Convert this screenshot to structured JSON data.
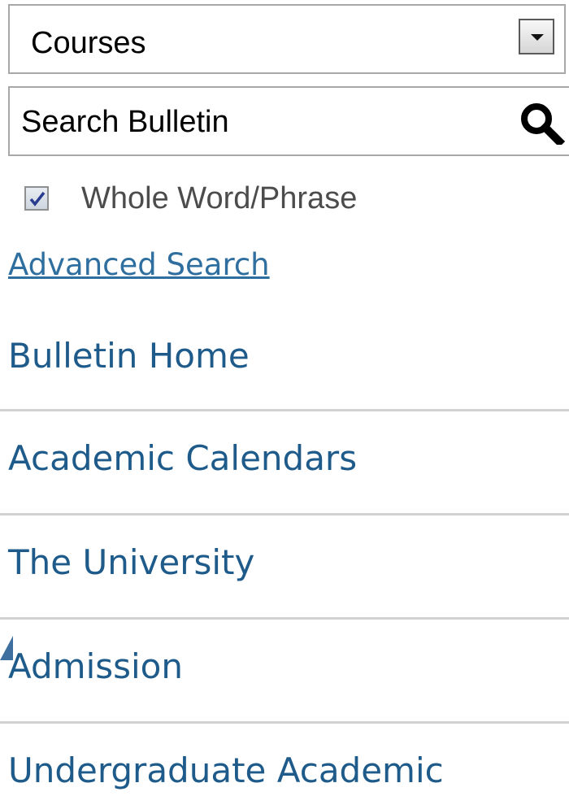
{
  "filter": {
    "selected": "Courses"
  },
  "search": {
    "placeholder": "Search Bulletin",
    "button_icon": "magnifier-icon"
  },
  "options": {
    "whole_word_label": "Whole Word/Phrase",
    "whole_word_checked": true
  },
  "advanced_search_label": "Advanced Search",
  "nav": {
    "items": [
      {
        "label": "Bulletin Home"
      },
      {
        "label": "Academic Calendars"
      },
      {
        "label": "The University"
      },
      {
        "label": "Admission"
      },
      {
        "label": "Undergraduate Academic"
      }
    ]
  },
  "colors": {
    "link": "#1e5b8a",
    "adv_link": "#2f6fa0",
    "divider": "#d2d2d2",
    "border": "#a8a8a8"
  }
}
